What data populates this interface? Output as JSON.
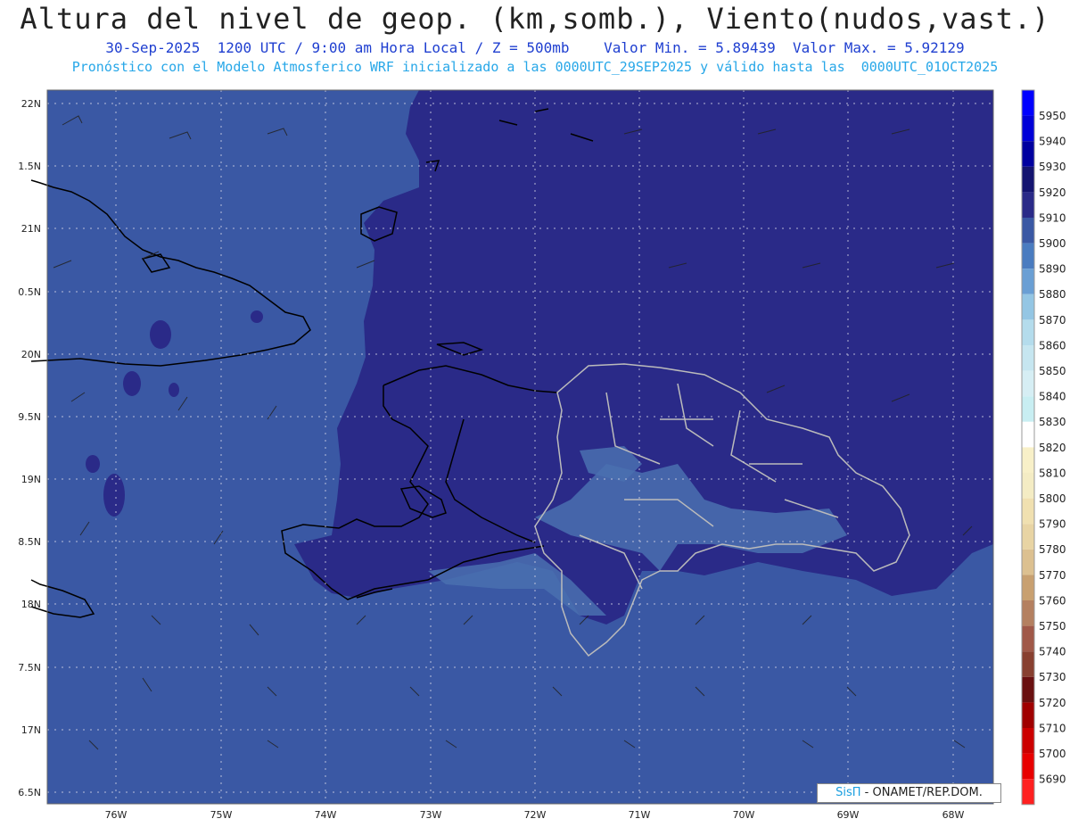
{
  "title": "Altura del nivel de geop. (km,somb.), Viento(nudos,vast.)",
  "subtitle_line1": "30-Sep-2025  1200 UTC / 9:00 am Hora Local / Z = 500mb    Valor Min. = 5.89439  Valor Max. = 5.92129",
  "subtitle_line2": "Pronóstico con el Modelo Atmosferico WRF inicializado a las 0000UTC_29SEP2025 y válido hasta las  0000UTC_01OCT2025",
  "credit": {
    "brand": "SisΠ",
    "text": " - ONAMET/REP.DOM."
  },
  "lat_labels": [
    "22N",
    "1.5N",
    "21N",
    "0.5N",
    "20N",
    "9.5N",
    "19N",
    "8.5N",
    "18N",
    "7.5N",
    "17N",
    "6.5N"
  ],
  "lon_labels": [
    "76W",
    "75W",
    "74W",
    "73W",
    "72W",
    "71W",
    "70W",
    "69W",
    "68W"
  ],
  "colorbar": [
    {
      "v": "5950",
      "c": "#0000ff"
    },
    {
      "v": "5940",
      "c": "#0000d8"
    },
    {
      "v": "5930",
      "c": "#0000a0"
    },
    {
      "v": "5920",
      "c": "#141470"
    },
    {
      "v": "5910",
      "c": "#2a2a88"
    },
    {
      "v": "5900",
      "c": "#3a58a4"
    },
    {
      "v": "5890",
      "c": "#4a7cc0"
    },
    {
      "v": "5880",
      "c": "#6a9fd4"
    },
    {
      "v": "5870",
      "c": "#94c6e4"
    },
    {
      "v": "5860",
      "c": "#b4dcec"
    },
    {
      "v": "5850",
      "c": "#c6e6f0"
    },
    {
      "v": "5840",
      "c": "#d6eef4"
    },
    {
      "v": "5830",
      "c": "#c8eef2"
    },
    {
      "v": "5820",
      "c": "#ffffff"
    },
    {
      "v": "5810",
      "c": "#f8f0c8"
    },
    {
      "v": "5800",
      "c": "#f4ecc4"
    },
    {
      "v": "5790",
      "c": "#f0e0b0"
    },
    {
      "v": "5780",
      "c": "#e8d4a4"
    },
    {
      "v": "5770",
      "c": "#dcc090"
    },
    {
      "v": "5760",
      "c": "#c8a070"
    },
    {
      "v": "5750",
      "c": "#b48060"
    },
    {
      "v": "5740",
      "c": "#a05848"
    },
    {
      "v": "5730",
      "c": "#884030"
    },
    {
      "v": "5720",
      "c": "#6a1010"
    },
    {
      "v": "5710",
      "c": "#a00000"
    },
    {
      "v": "5700",
      "c": "#cc0000"
    },
    {
      "v": "5690",
      "c": "#e80000"
    },
    {
      "v": "",
      "c": "#ff2020"
    }
  ],
  "colors": {
    "low_shade": "#3a58a4",
    "high_shade": "#2a2a88",
    "mid_shade": "#4a70b0"
  }
}
